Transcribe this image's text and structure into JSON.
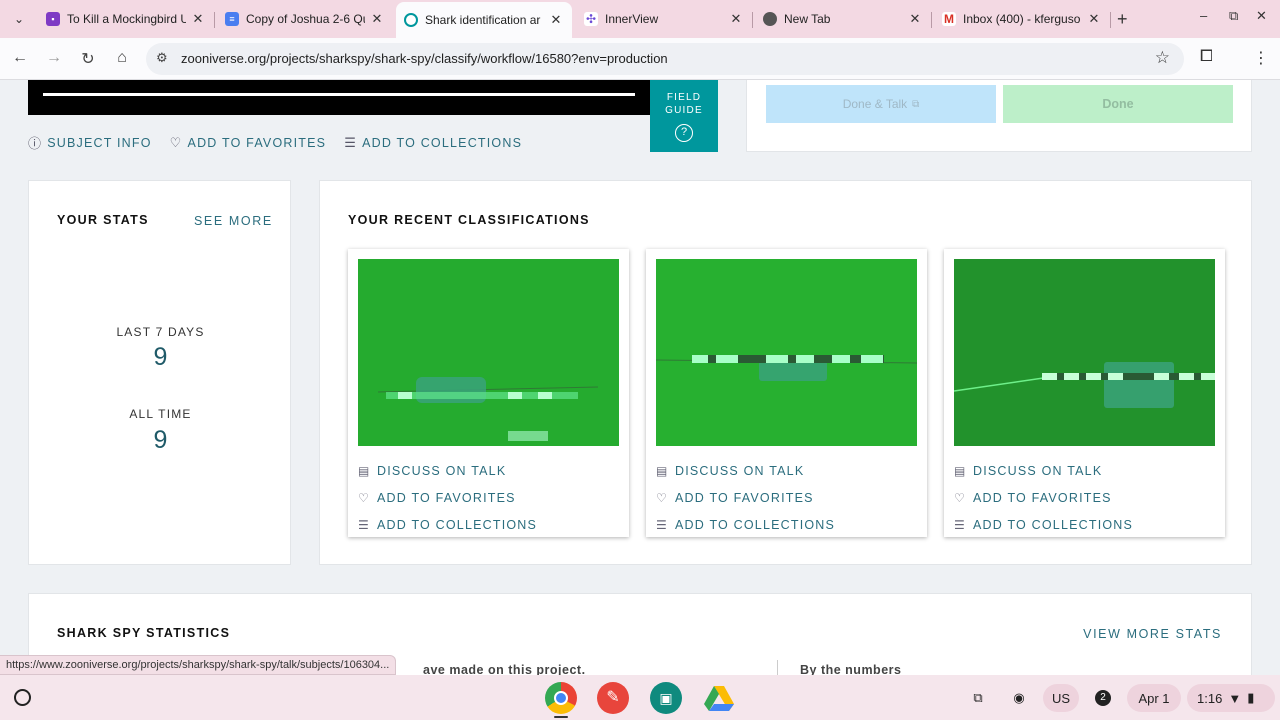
{
  "browser": {
    "tabs": [
      {
        "title": "To Kill a Mockingbird U",
        "favicon": "classroom-icon",
        "color": "#7e3ac4"
      },
      {
        "title": "Copy of Joshua 2-6 Qu",
        "favicon": "docs-icon",
        "color": "#4a7ef0"
      },
      {
        "title": "Shark identification ar",
        "favicon": "zooniverse-icon",
        "color": "#00979d",
        "active": true
      },
      {
        "title": "InnerView",
        "favicon": "innerview-icon",
        "color": "#6c4ad6"
      },
      {
        "title": "New Tab",
        "favicon": "chrome-icon",
        "color": "#555555"
      },
      {
        "title": "Inbox (400) - kferguso",
        "favicon": "gmail-icon",
        "color": "#d93025"
      }
    ],
    "url": "zooniverse.org/projects/sharkspy/shark-spy/classify/workflow/16580?env=production",
    "status_url": "https://www.zooniverse.org/projects/sharkspy/shark-spy/talk/subjects/106304..."
  },
  "classifier": {
    "field_guide_line1": "FIELD",
    "field_guide_line2": "GUIDE",
    "field_guide_icon": "?",
    "subject_info": "SUBJECT INFO",
    "add_to_favorites": "ADD TO FAVORITES",
    "add_to_collections": "ADD TO COLLECTIONS",
    "done_talk": "Done & Talk",
    "done": "Done"
  },
  "stats": {
    "heading": "YOUR STATS",
    "see_more": "SEE MORE",
    "last7_label": "LAST 7 DAYS",
    "last7_value": "9",
    "alltime_label": "ALL TIME",
    "alltime_value": "9"
  },
  "recent": {
    "heading": "YOUR RECENT CLASSIFICATIONS",
    "actions": {
      "discuss": "DISCUSS ON TALK",
      "favorites": "ADD TO FAVORITES",
      "collections": "ADD TO COLLECTIONS"
    }
  },
  "shark_spy": {
    "heading": "SHARK SPY STATISTICS",
    "view_more": "VIEW MORE STATS",
    "partial_left": "ave made on this project.",
    "partial_right": "By the numbers"
  },
  "shelf": {
    "tray": {
      "us": "US",
      "notifications": "2",
      "date": "Apr 1",
      "time": "1:16"
    }
  },
  "colors": {
    "accent": "#00979d",
    "link": "#2b6d7e",
    "stat_value": "#1f5a68"
  }
}
